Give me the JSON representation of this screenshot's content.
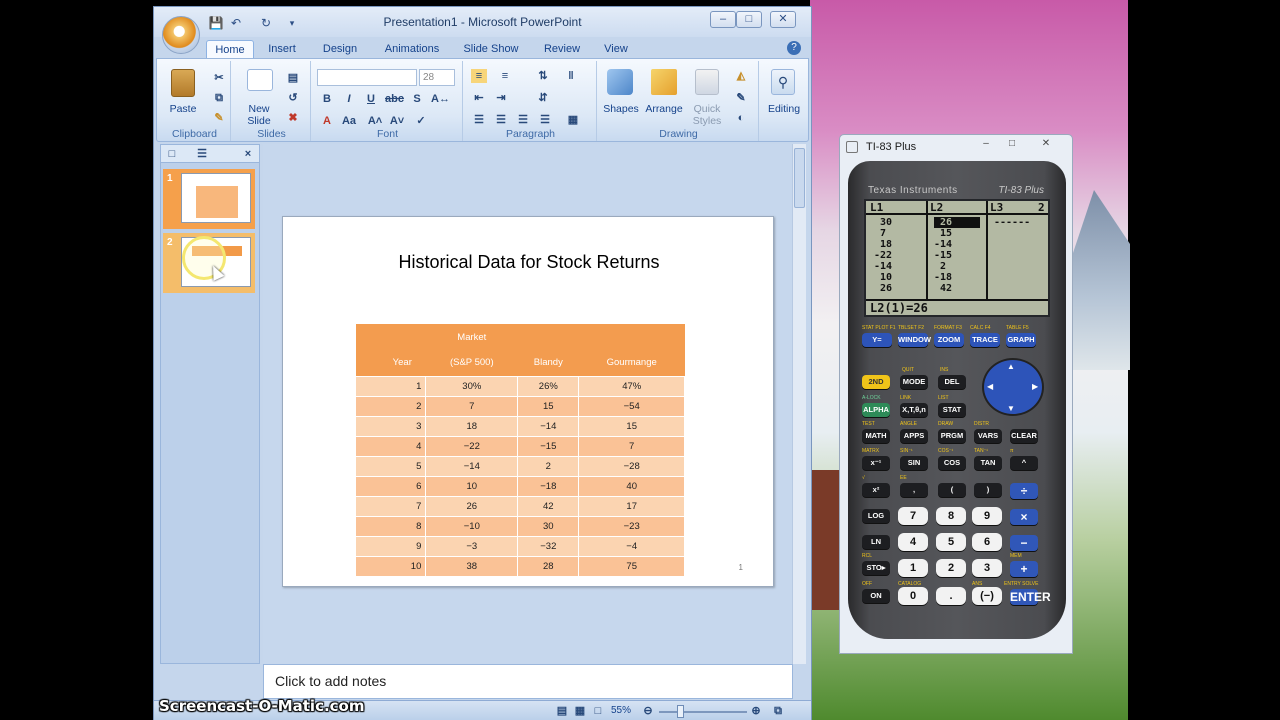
{
  "ppt": {
    "window_title": "Presentation1 - Microsoft PowerPoint",
    "tabs": [
      "Home",
      "Insert",
      "Design",
      "Animations",
      "Slide Show",
      "Review",
      "View"
    ],
    "active_tab": "Home",
    "ribbon": {
      "paste_label": "Paste",
      "new_slide_label": "New",
      "new_slide_label2": "Slide",
      "font_size_value": "28",
      "shapes_label": "Shapes",
      "arrange_label": "Arrange",
      "quick_styles_label": "Quick",
      "quick_styles_label2": "Styles",
      "editing_label": "Editing",
      "groups": [
        "Clipboard",
        "Slides",
        "Font",
        "Paragraph",
        "Drawing"
      ]
    },
    "slide_thumbs": [
      "1",
      "2"
    ],
    "slide": {
      "title": "Historical Data for Stock Returns",
      "number": "1",
      "table": {
        "header_top": "Market",
        "headers": [
          "Year",
          "(S&P 500)",
          "Blandy",
          "Gourmange"
        ],
        "rows": [
          [
            "1",
            "30%",
            "26%",
            "47%"
          ],
          [
            "2",
            "7",
            "15",
            "−54"
          ],
          [
            "3",
            "18",
            "−14",
            "15"
          ],
          [
            "4",
            "−22",
            "−15",
            "7"
          ],
          [
            "5",
            "−14",
            "2",
            "−28"
          ],
          [
            "6",
            "10",
            "−18",
            "40"
          ],
          [
            "7",
            "26",
            "42",
            "17"
          ],
          [
            "8",
            "−10",
            "30",
            "−23"
          ],
          [
            "9",
            "−3",
            "−32",
            "−4"
          ],
          [
            "10",
            "38",
            "28",
            "75"
          ]
        ]
      }
    },
    "notes_placeholder": "Click to add notes",
    "zoom": "55%"
  },
  "calc": {
    "window_title": "TI-83 Plus",
    "brand": "Texas Instruments",
    "model": "TI-83 Plus",
    "screen": {
      "headers": [
        "L1",
        "L2",
        "L3",
        "2"
      ],
      "l1": [
        "30",
        "7",
        "18",
        "-22",
        "-14",
        "10",
        "26"
      ],
      "l2": [
        "26",
        "15",
        "-14",
        "-15",
        "2",
        "-18",
        "42"
      ],
      "l3": [
        "------"
      ],
      "footer": "L2(1)=26"
    },
    "func_keys": [
      "Y=",
      "WINDOW",
      "ZOOM",
      "TRACE",
      "GRAPH"
    ],
    "func_secondary": [
      "STAT PLOT F1",
      "TBLSET F2",
      "FORMAT F3",
      "CALC F4",
      "TABLE F5"
    ],
    "keys": {
      "row1": [
        "2ND",
        "MODE",
        "DEL"
      ],
      "row2": [
        "ALPHA",
        "X,T,θ,n",
        "STAT"
      ],
      "row3": [
        "MATH",
        "APPS",
        "PRGM",
        "VARS",
        "CLEAR"
      ],
      "row4": [
        "x⁻¹",
        "SIN",
        "COS",
        "TAN",
        "^"
      ],
      "row5": [
        "x²",
        ",",
        "(",
        ")",
        "÷"
      ],
      "row6": [
        "LOG",
        "7",
        "8",
        "9",
        "×"
      ],
      "row7": [
        "LN",
        "4",
        "5",
        "6",
        "−"
      ],
      "row8": [
        "STO▸",
        "1",
        "2",
        "3",
        "+"
      ],
      "row9": [
        "ON",
        "0",
        ".",
        "(−)",
        "ENTER"
      ]
    },
    "secondary_labels": {
      "quit": "QUIT",
      "ins": "INS",
      "alock": "A-LOCK",
      "link": "LINK",
      "list": "LIST",
      "test": "TEST",
      "angle": "ANGLE",
      "draw": "DRAW",
      "distr": "DISTR",
      "matrx": "MATRX",
      "sin1": "SIN⁻¹",
      "cos1": "COS⁻¹",
      "tan1": "TAN⁻¹",
      "pi": "π",
      "sqrt": "√",
      "ee": "EE",
      "rcl": "RCL",
      "mem": "MEM",
      "off": "OFF",
      "catalog": "CATALOG",
      "ans": "ANS",
      "entry": "ENTRY SOLVE"
    }
  },
  "watermark": "Screencast-O-Matic.com"
}
